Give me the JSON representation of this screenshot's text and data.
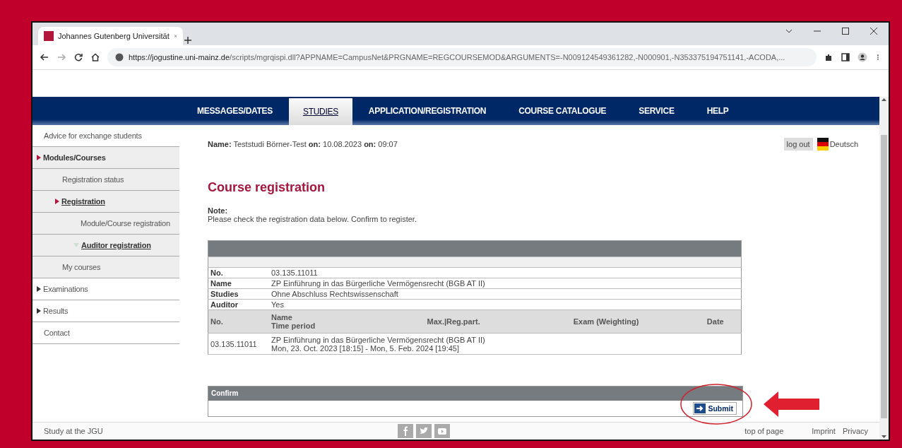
{
  "browser": {
    "tab_title": "Johannes Gutenberg Universität",
    "url_host": "https://jogustine.uni-mainz.de",
    "url_path": "/scripts/mgrqispi.dll?APPNAME=CampusNet&PRGNAME=REGCOURSEMOD&ARGUMENTS=-N009124549361282,-N000901,-N353375194751141,-ACODA,..."
  },
  "nav": [
    {
      "label": "MESSAGES/DATES",
      "selected": false
    },
    {
      "label": "STUDIES",
      "selected": true
    },
    {
      "label": "APPLICATION/REGISTRATION",
      "selected": false
    },
    {
      "label": "COURSE CATALOGUE",
      "selected": false
    },
    {
      "label": "SERVICE",
      "selected": false
    },
    {
      "label": "HELP",
      "selected": false
    }
  ],
  "sidebar": [
    {
      "label": "Advice for exchange students",
      "selected": false
    },
    {
      "label": "Modules/Courses",
      "selected": false,
      "expanded": true,
      "children": [
        {
          "label": "Registration status",
          "selected": false
        },
        {
          "label": "Registration",
          "selected": true,
          "expanded": true,
          "children": [
            {
              "label": "Module/Course registration",
              "selected": false
            },
            {
              "label": "Auditor registration",
              "selected": true
            }
          ]
        },
        {
          "label": "My courses",
          "selected": false
        }
      ]
    },
    {
      "label": "Examinations",
      "selected": false,
      "expanded": false
    },
    {
      "label": "Results",
      "selected": false,
      "expanded": false
    },
    {
      "label": "Contact",
      "selected": false
    }
  ],
  "user_line": "**Name:** Teststudi Börner-Test **on:** 10.08.2023 **on:** 09:07",
  "logout": "log out",
  "language": "Deutsch",
  "title": "Course registration",
  "note_label": "Note:",
  "note": "Please check the registration data below. Confirm to register.",
  "details": [
    {
      "label": "No.",
      "value": "03.135.11011"
    },
    {
      "label": "Name",
      "value": "ZP Einführung in das Bürgerliche Vermögensrecht (BGB AT II)"
    },
    {
      "label": "Studies",
      "value": "Ohne Abschluss Rechtswissenschaft"
    },
    {
      "label": "Auditor",
      "value": "Yes"
    }
  ],
  "courses": {
    "columns": [
      {
        "label": "No."
      },
      {
        "label": "Name",
        "sublabel": "Time period"
      },
      {
        "label": "Max.|Reg.part."
      },
      {
        "label": "Exam  (Weighting)"
      },
      {
        "label": "Date"
      }
    ],
    "rows": [
      {
        "no": "03.135.11011",
        "name": "ZP Einführung in das Bürgerliche Vermögensrecht (BGB AT II)",
        "period": "Mon, 23. Oct. 2023 [18:15] - Mon, 5. Feb. 2024 [19:45]"
      }
    ]
  },
  "confirm": {
    "title": "Confirm",
    "button": "Submit"
  },
  "footer": {
    "left": "Study at the JGU",
    "links": [
      "top of page",
      "Imprint",
      "Privacy"
    ]
  }
}
